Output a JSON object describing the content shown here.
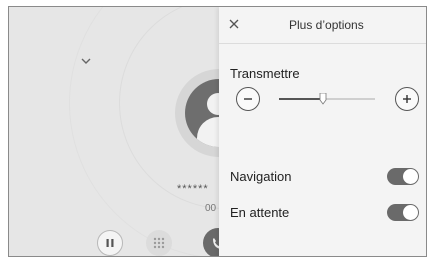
{
  "call": {
    "number": "******",
    "duration": "00"
  },
  "panel": {
    "title": "Plus d’options",
    "close_icon": "close-icon",
    "volume": {
      "label": "Transmettre",
      "level": 0.46,
      "minus_icon": "minus-icon",
      "plus_icon": "plus-icon"
    },
    "toggles": [
      {
        "label": "Navigation",
        "on": true
      },
      {
        "label": "En attente",
        "on": true
      }
    ]
  },
  "colors": {
    "panel_bg": "#f4f4f4",
    "toggle_on": "#6a6a6a",
    "dim_bg": "#e6e6e6"
  }
}
